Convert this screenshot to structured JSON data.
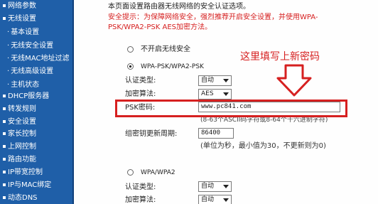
{
  "sidebar": {
    "items": [
      {
        "label": "网络参数",
        "type": "top"
      },
      {
        "label": "无线设置",
        "type": "top"
      },
      {
        "label": "基本设置",
        "type": "sub"
      },
      {
        "label": "无线安全设置",
        "type": "sub"
      },
      {
        "label": "无线MAC地址过滤",
        "type": "sub"
      },
      {
        "label": "无线高级设置",
        "type": "sub"
      },
      {
        "label": "主机状态",
        "type": "sub"
      },
      {
        "label": "DHCP服务器",
        "type": "top"
      },
      {
        "label": "转发规则",
        "type": "top"
      },
      {
        "label": "安全设置",
        "type": "top"
      },
      {
        "label": "家长控制",
        "type": "top"
      },
      {
        "label": "上网控制",
        "type": "top"
      },
      {
        "label": "路由功能",
        "type": "top"
      },
      {
        "label": "IP带宽控制",
        "type": "top"
      },
      {
        "label": "IP与MAC绑定",
        "type": "top"
      },
      {
        "label": "动态DNS",
        "type": "top"
      }
    ]
  },
  "intro": {
    "line1": "本页面设置路由器无线网络的安全认证选项。",
    "line2": "安全提示：为保障网络安全，强烈推荐开启安全设置，并使用WPA-",
    "line3": "PSK/WPA2-PSK AES加密方法。"
  },
  "options": {
    "none_label": "不开启无线安全",
    "wpa_psk_label": "WPA-PSK/WPA2-PSK",
    "wpa_label": "WPA/WPA2"
  },
  "wpa_psk": {
    "auth_label": "认证类型:",
    "auth_value": "自动",
    "encrypt_label": "加密算法:",
    "encrypt_value": "AES",
    "psk_label": "PSK密码:",
    "psk_value": "www.pc841.com",
    "psk_hint": "(8-63个ASCII码字符或8-64个十六进制字符)",
    "renew_label": "组密钥更新周期:",
    "renew_value": "86400",
    "renew_hint": "(单位为秒，最小值为30，不更新则为0)"
  },
  "wpa": {
    "auth_label": "认证类型:",
    "auth_value": "自动",
    "encrypt_label": "加密算法:",
    "encrypt_value": "自动"
  },
  "annotation": {
    "text": "这里填写上新密码",
    "color": "#d62020"
  },
  "icons": {
    "arrow": "down-arrow-icon"
  }
}
